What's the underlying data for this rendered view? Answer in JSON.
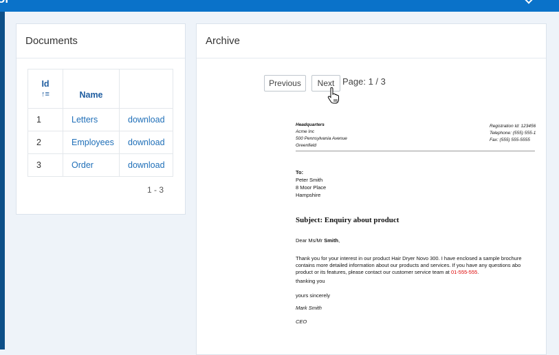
{
  "topbar": {
    "brand": "UI",
    "accent": "#0a72c9"
  },
  "documents": {
    "title": "Documents",
    "columns": {
      "id": "Id",
      "name": "Name"
    },
    "sort_icon": "sort-ascending-icon",
    "rows": [
      {
        "id": "1",
        "name": "Letters",
        "action": "download"
      },
      {
        "id": "2",
        "name": "Employees",
        "action": "download"
      },
      {
        "id": "3",
        "name": "Order",
        "action": "download"
      }
    ],
    "range": "1 - 3"
  },
  "archive": {
    "title": "Archive",
    "prev_label": "Previous",
    "next_label": "Next",
    "page_label": "Page: 1 / 3"
  },
  "letter": {
    "hq": [
      "Headquarters",
      "Acme Inc",
      "500 Pennsylvania Avenue",
      "Greenfield"
    ],
    "reg": [
      "Registration Id: 123456",
      "Telephone: (555) 555-1",
      "Fax: (555) 555-5555"
    ],
    "to_label": "To:",
    "to": [
      "Peter Smith",
      "8 Moor Place",
      "Hampshire"
    ],
    "subject": "Subject: Enquiry about product",
    "dear_prefix": "Dear Ms/Mr ",
    "dear_name": "Smith",
    "dear_suffix": ",",
    "body1": "Thank you for your interest in our product Hair Dryer Novo 300. I have enclosed a sample brochure",
    "body2": "contains more detailed information about our products and services. If you have any questions abo",
    "body3_prefix": "product or its features, please contact our customer service team at ",
    "body3_phone": "01-555-555",
    "body3_suffix": ".",
    "thanking": "thanking you",
    "yours": "yours sincerely",
    "signer": "Mark Smith",
    "role": "CEO"
  }
}
